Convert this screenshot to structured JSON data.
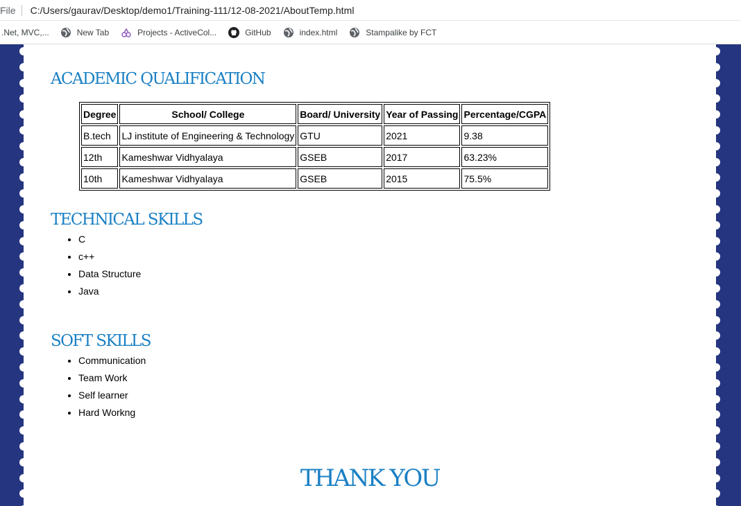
{
  "browser": {
    "scheme_label": "File",
    "url": "C:/Users/gaurav/Desktop/demo1/Training-111/12-08-2021/AboutTemp.html"
  },
  "bookmarks": [
    {
      "label": ".Net, MVC,...",
      "icon": "none"
    },
    {
      "label": "New Tab",
      "icon": "globe-icon"
    },
    {
      "label": "Projects - ActiveCol...",
      "icon": "projects-icon"
    },
    {
      "label": "GitHub",
      "icon": "github-icon"
    },
    {
      "label": "index.html",
      "icon": "globe-icon"
    },
    {
      "label": "Stampalike by FCT",
      "icon": "globe-icon"
    }
  ],
  "colors": {
    "stamp_edge": "#25357f",
    "heading": "#1a80c4"
  },
  "academic": {
    "heading": "ACADEMIC QUALIFICATION",
    "columns": [
      "Degree",
      "School/ College",
      "Board/ University",
      "Year of Passing",
      "Percentage/CGPA"
    ],
    "rows": [
      [
        "B.tech",
        "LJ institute of Engineering & Technology",
        "GTU",
        "2021",
        "9.38"
      ],
      [
        "12th",
        "Kameshwar Vidhyalaya",
        "GSEB",
        "2017",
        "63.23%"
      ],
      [
        "10th",
        "Kameshwar Vidhyalaya",
        "GSEB",
        "2015",
        "75.5%"
      ]
    ]
  },
  "technical": {
    "heading": "TECHNICAL SKILLS",
    "items": [
      "C",
      "c++",
      "Data Structure",
      "Java"
    ]
  },
  "soft": {
    "heading": "SOFT SKILLS",
    "items": [
      "Communication",
      "Team Work",
      "Self learner",
      "Hard Workng"
    ]
  },
  "closing": "THANK YOU"
}
